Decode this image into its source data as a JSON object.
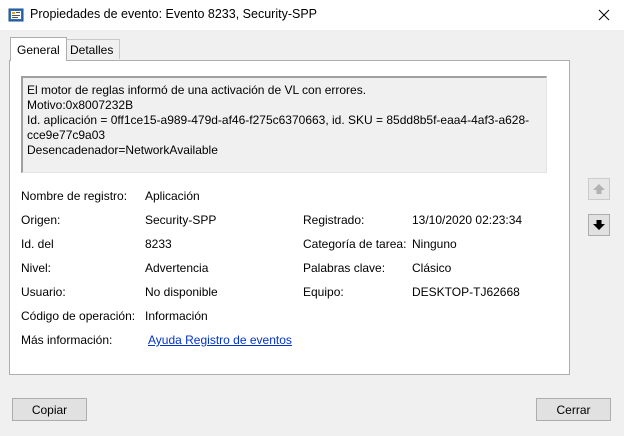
{
  "window": {
    "title": "Propiedades de evento: Evento 8233, Security-SPP",
    "app_icon": "event-viewer-icon",
    "close_icon": "close-icon"
  },
  "tabs": [
    {
      "label": "General",
      "active": true
    },
    {
      "label": "Detalles",
      "active": false
    }
  ],
  "description": "El motor de reglas informó de una activación de VL con errores.\nMotivo:0x8007232B\nId. aplicación = 0ff1ce15-a989-479d-af46-f275c6370663, id. SKU = 85dd8b5f-eaa4-4af3-a628-\ncce9e77c9a03\nDesencadenador=NetworkAvailable",
  "fields": {
    "log_name": {
      "label": "Nombre de registro:",
      "value": "Aplicación"
    },
    "source": {
      "label": "Origen:",
      "value": "Security-SPP"
    },
    "logged": {
      "label": "Registrado:",
      "value": "13/10/2020 02:23:34"
    },
    "event_id": {
      "label": "Id. del",
      "value": "8233"
    },
    "task_category": {
      "label": "Categoría de tarea:",
      "value": "Ninguno"
    },
    "level": {
      "label": "Nivel:",
      "value": "Advertencia"
    },
    "keywords": {
      "label": "Palabras clave:",
      "value": "Clásico"
    },
    "user": {
      "label": "Usuario:",
      "value": "No disponible"
    },
    "computer": {
      "label": "Equipo:",
      "value": "DESKTOP-TJ62668"
    },
    "opcode": {
      "label": "Código de operación:",
      "value": "Información"
    },
    "more_info": {
      "label": "Más información:",
      "value": "Ayuda Registro de eventos"
    }
  },
  "buttons": {
    "copy": "Copiar",
    "close": "Cerrar"
  },
  "nav": {
    "up_icon": "arrow-up-icon",
    "down_icon": "arrow-down-icon"
  }
}
